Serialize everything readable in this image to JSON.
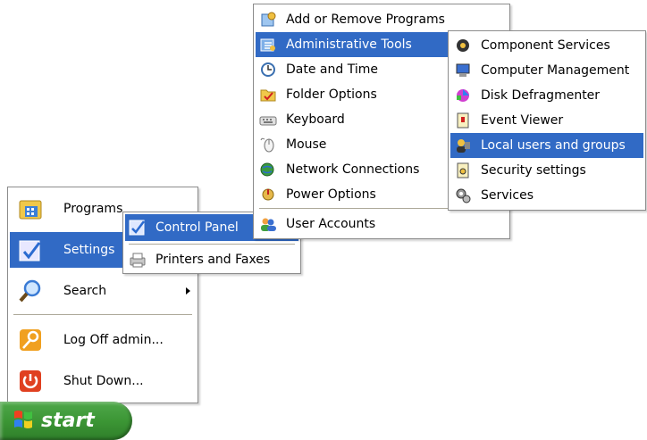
{
  "start_menu": {
    "items": [
      {
        "label": "Programs",
        "icon": "programs-icon"
      },
      {
        "label": "Settings",
        "icon": "settings-icon"
      },
      {
        "label": "Search",
        "icon": "search-icon"
      },
      {
        "label": "Log Off admin...",
        "icon": "log-off-icon"
      },
      {
        "label": "Shut Down...",
        "icon": "shut-down-icon"
      }
    ]
  },
  "settings_menu": {
    "items": [
      {
        "label": "Control Panel",
        "icon": "control-panel-icon"
      },
      {
        "label": "Printers and Faxes",
        "icon": "printers-icon"
      }
    ]
  },
  "control_panel_menu": {
    "items": [
      {
        "label": "Add or Remove Programs"
      },
      {
        "label": "Administrative Tools"
      },
      {
        "label": "Date and Time"
      },
      {
        "label": "Folder Options"
      },
      {
        "label": "Keyboard"
      },
      {
        "label": "Mouse"
      },
      {
        "label": "Network Connections"
      },
      {
        "label": "Power Options"
      },
      {
        "label": "User Accounts"
      }
    ]
  },
  "admin_tools_menu": {
    "items": [
      {
        "label": "Component Services"
      },
      {
        "label": "Computer Management"
      },
      {
        "label": "Disk Defragmenter"
      },
      {
        "label": "Event Viewer"
      },
      {
        "label": "Local users and groups"
      },
      {
        "label": "Security settings"
      },
      {
        "label": "Services"
      }
    ]
  },
  "start_button": {
    "label": "start"
  },
  "colors": {
    "highlight": "#316ac5",
    "start_green": "#3c9635"
  }
}
